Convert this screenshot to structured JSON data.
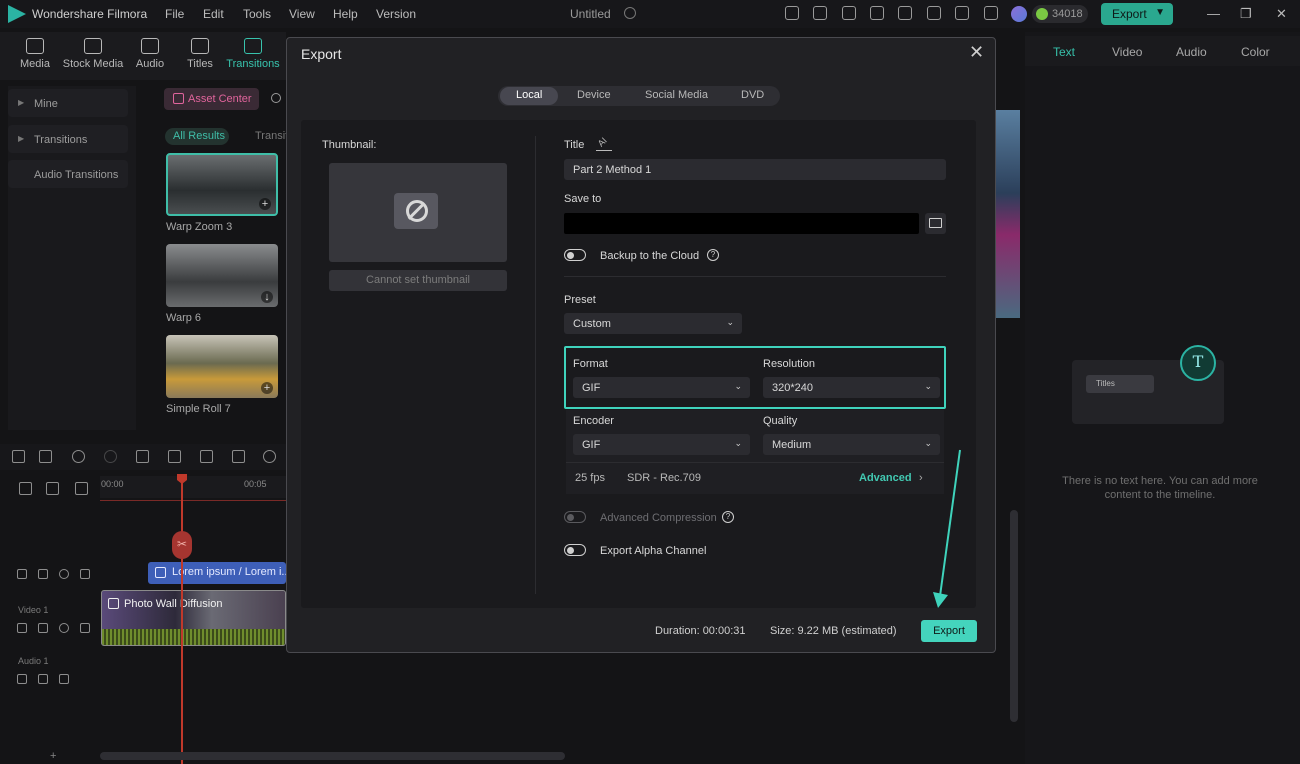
{
  "titlebar": {
    "app_name": "Wondershare Filmora",
    "menu": [
      "File",
      "Edit",
      "Tools",
      "View",
      "Help",
      "Version"
    ],
    "doc_title": "Untitled",
    "coins": "34018",
    "export_label": "Export"
  },
  "media_tabs": [
    "Media",
    "Stock Media",
    "Audio",
    "Titles",
    "Transitions"
  ],
  "side_nav": [
    "Mine",
    "Transitions",
    "Audio Transitions"
  ],
  "asset_center": "Asset Center",
  "filters": {
    "all": "All Results",
    "transitions": "Transiti"
  },
  "thumbs": [
    {
      "label": "Warp Zoom 3"
    },
    {
      "label": "Warp 6"
    },
    {
      "label": "Simple Roll 7"
    }
  ],
  "timeline": {
    "ruler": [
      "00:00",
      "00:05"
    ],
    "title_clip": "Lorem ipsum / Lorem i...",
    "video_clip": "Photo Wall Diffusion",
    "tracks": {
      "video": "Video 1",
      "audio": "Audio 1"
    }
  },
  "right_panel": {
    "tabs": [
      "Text",
      "Video",
      "Audio",
      "Color"
    ],
    "illus_title": "Titles",
    "illus_badge": "T",
    "empty_msg": "There is no text here. You can add more content to the timeline."
  },
  "dialog": {
    "title": "Export",
    "tabs": [
      "Local",
      "Device",
      "Social Media",
      "DVD"
    ],
    "thumbnail_label": "Thumbnail:",
    "thumbnail_btn": "Cannot set thumbnail",
    "title_label": "Title",
    "title_edit_hint": "AI",
    "title_value": "Part 2 Method 1",
    "save_to_label": "Save to",
    "backup_label": "Backup to the Cloud",
    "preset_label": "Preset",
    "preset_value": "Custom",
    "format_label": "Format",
    "format_value": "GIF",
    "resolution_label": "Resolution",
    "resolution_value": "320*240",
    "encoder_label": "Encoder",
    "encoder_value": "GIF",
    "quality_label": "Quality",
    "quality_value": "Medium",
    "fps": "25 fps",
    "color_space": "SDR - Rec.709",
    "advanced_label": "Advanced",
    "adv_compression_label": "Advanced Compression",
    "alpha_label": "Export Alpha Channel",
    "duration": "Duration: 00:00:31",
    "size": "Size:  9.22 MB (estimated)",
    "export_label": "Export"
  },
  "colors": {
    "accent": "#3fd3bc",
    "arrow": "#3fd3bc"
  }
}
